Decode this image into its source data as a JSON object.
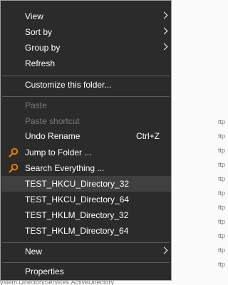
{
  "menu": {
    "items": [
      {
        "label": "View",
        "shortcut": ""
      },
      {
        "label": "Sort by",
        "shortcut": ""
      },
      {
        "label": "Group by",
        "shortcut": ""
      },
      {
        "label": "Refresh",
        "shortcut": ""
      },
      {
        "label": "Customize this folder...",
        "shortcut": ""
      },
      {
        "label": "Paste",
        "shortcut": ""
      },
      {
        "label": "Paste shortcut",
        "shortcut": ""
      },
      {
        "label": "Undo Rename",
        "shortcut": "Ctrl+Z"
      },
      {
        "label": "Jump to Folder ...",
        "shortcut": ""
      },
      {
        "label": "Search Everything ...",
        "shortcut": ""
      },
      {
        "label": "TEST_HKCU_Directory_32",
        "shortcut": ""
      },
      {
        "label": "TEST_HKCU_Directory_64",
        "shortcut": ""
      },
      {
        "label": "TEST_HKLM_Directory_32",
        "shortcut": ""
      },
      {
        "label": "TEST_HKLM_Directory_64",
        "shortcut": ""
      },
      {
        "label": "New",
        "shortcut": ""
      },
      {
        "label": "Properties",
        "shortcut": ""
      }
    ]
  },
  "colors": {
    "menu_bg": "#2b2b2b",
    "hover_bg": "#404040",
    "text": "#ffffff",
    "disabled_text": "#7a7a7a",
    "icon_orange": "#f07800"
  },
  "background": {
    "visible_fragments": "ttp",
    "bottom_fragment": "ystem.DirectoryServices.ActiveDirectory"
  }
}
